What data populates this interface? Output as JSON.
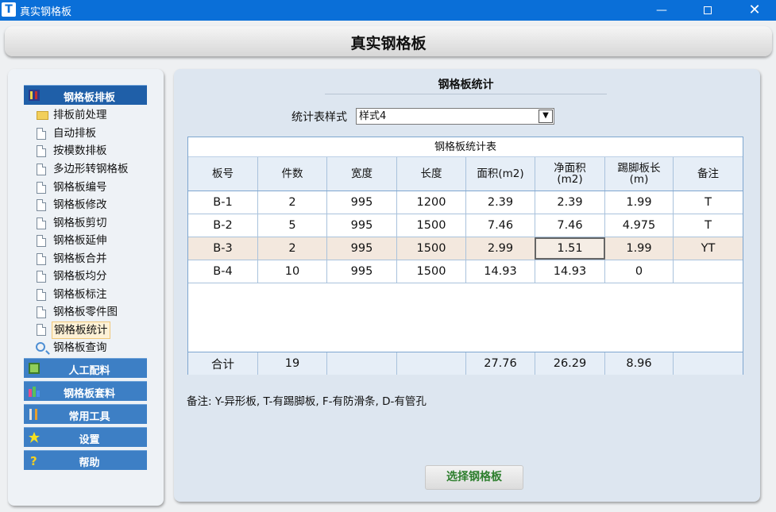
{
  "window": {
    "title": "真实钢格板",
    "app_icon": "T",
    "minimize": "—",
    "close": "✕"
  },
  "header": {
    "title": "真实钢格板"
  },
  "sidebar": {
    "categories": [
      {
        "label": "钢格板排板",
        "icon": "grid-icon",
        "color": "#1f5fa8"
      },
      {
        "label": "人工配料",
        "icon": "grid-icon",
        "color": "#3d7fc5"
      },
      {
        "label": "钢格板套料",
        "icon": "bar-chart-icon",
        "color": "#3d7fc5"
      },
      {
        "label": "常用工具",
        "icon": "tools-icon",
        "color": "#3d7fc5"
      },
      {
        "label": "设置",
        "icon": "gear-star-icon",
        "color": "#3d7fc5"
      },
      {
        "label": "帮助",
        "icon": "question-icon",
        "color": "#3d7fc5"
      }
    ],
    "items": [
      {
        "label": "排板前处理",
        "icon": "folder-icon"
      },
      {
        "label": "自动排板",
        "icon": "document-icon"
      },
      {
        "label": "按模数排板",
        "icon": "document-icon"
      },
      {
        "label": "多边形转钢格板",
        "icon": "document-icon"
      },
      {
        "label": "钢格板编号",
        "icon": "document-icon"
      },
      {
        "label": "钢格板修改",
        "icon": "document-icon"
      },
      {
        "label": "钢格板剪切",
        "icon": "document-icon"
      },
      {
        "label": "钢格板延伸",
        "icon": "document-icon"
      },
      {
        "label": "钢格板合并",
        "icon": "document-icon"
      },
      {
        "label": "钢格板均分",
        "icon": "document-icon"
      },
      {
        "label": "钢格板标注",
        "icon": "document-icon"
      },
      {
        "label": "钢格板零件图",
        "icon": "document-icon"
      },
      {
        "label": "钢格板统计",
        "icon": "document-icon",
        "selected": true
      },
      {
        "label": "钢格板查询",
        "icon": "search-icon"
      }
    ]
  },
  "main": {
    "title": "钢格板统计",
    "style_label": "统计表样式",
    "style_value": "样式4",
    "table": {
      "caption": "钢格板统计表",
      "headers": [
        [
          "板号"
        ],
        [
          "件数"
        ],
        [
          "宽度"
        ],
        [
          "长度"
        ],
        [
          "面积(m2)"
        ],
        [
          "净面积",
          "(m2)"
        ],
        [
          "踢脚板长",
          "(m)"
        ],
        [
          "备注"
        ]
      ],
      "rows": [
        [
          "B-1",
          "2",
          "995",
          "1200",
          "2.39",
          "2.39",
          "1.99",
          "T"
        ],
        [
          "B-2",
          "5",
          "995",
          "1500",
          "7.46",
          "7.46",
          "4.975",
          "T"
        ],
        [
          "B-3",
          "2",
          "995",
          "1500",
          "2.99",
          "1.51",
          "1.99",
          "YT"
        ],
        [
          "B-4",
          "10",
          "995",
          "1500",
          "14.93",
          "14.93",
          "0",
          ""
        ]
      ],
      "total": [
        "合计",
        "19",
        "",
        "",
        "27.76",
        "26.29",
        "8.96",
        ""
      ]
    },
    "note": "备注: Y-异形板, T-有踢脚板, F-有防滑条, D-有管孔",
    "select_button": "选择钢格板"
  }
}
